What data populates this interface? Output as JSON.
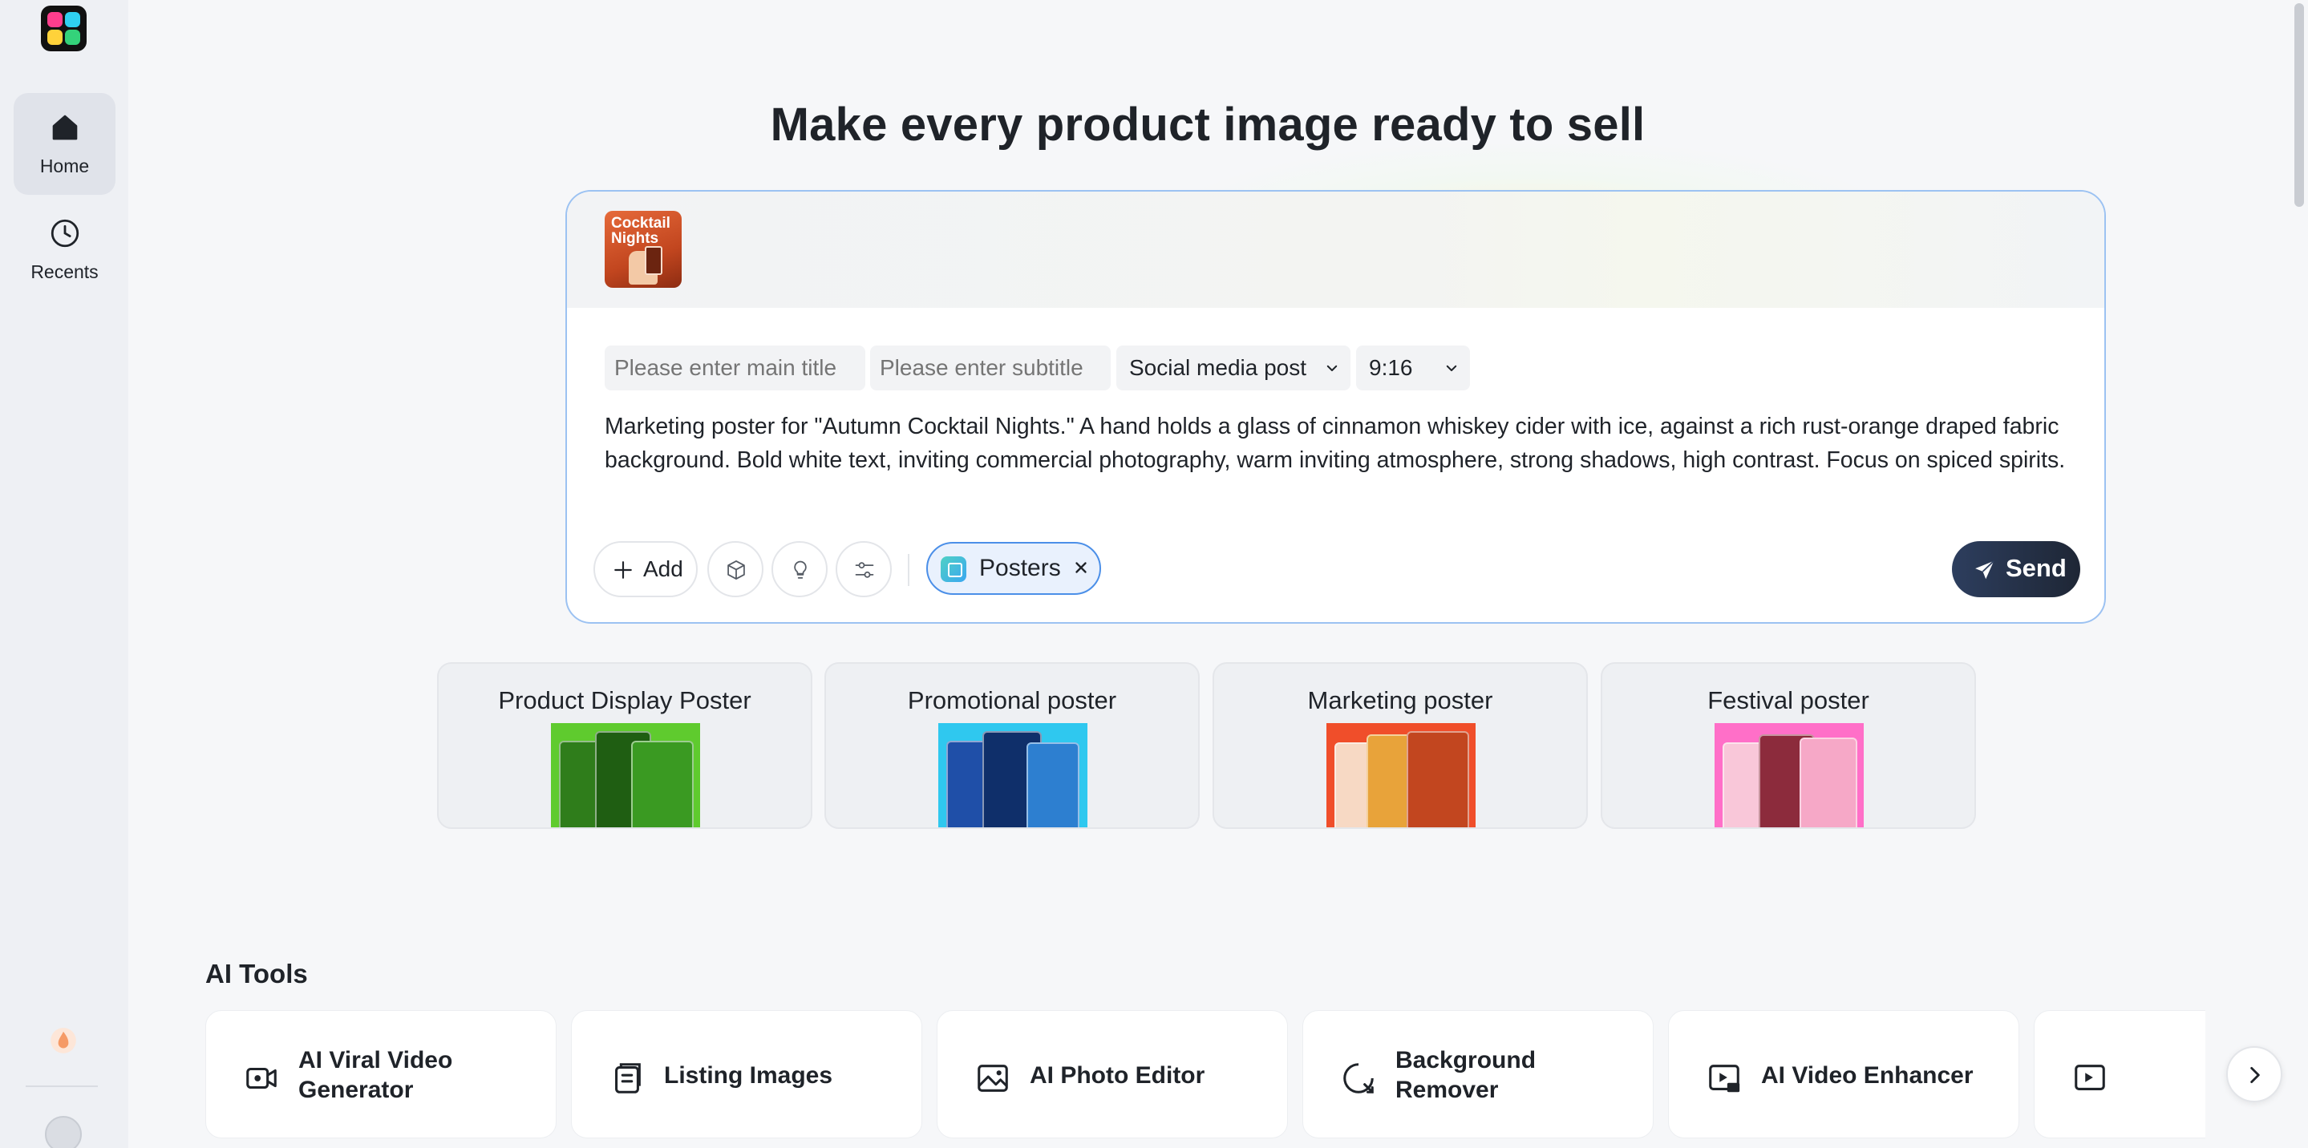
{
  "sidebar": {
    "items": [
      {
        "label": "Home",
        "icon": "home-icon",
        "active": true
      },
      {
        "label": "Recents",
        "icon": "clock-icon",
        "active": false
      }
    ]
  },
  "hero": {
    "title": "Make every product image ready to sell"
  },
  "composer": {
    "attachment_thumb_text": "Cocktail Nights",
    "main_title_placeholder": "Please enter main title",
    "subtitle_placeholder": "Please enter subtitle",
    "post_type": "Social media post",
    "aspect_ratio": "9:16",
    "prompt": "Marketing poster for \"Autumn Cocktail Nights.\" A hand holds a glass of cinnamon whiskey cider with ice, against a rich rust-orange draped fabric background. Bold white text, inviting commercial photography, warm inviting atmosphere, strong shadows, high contrast. Focus on spiced spirits.",
    "add_label": "Add",
    "chip_label": "Posters",
    "send_label": "Send"
  },
  "templates": [
    {
      "title": "Product Display Poster"
    },
    {
      "title": "Promotional poster"
    },
    {
      "title": "Marketing poster"
    },
    {
      "title": "Festival poster"
    }
  ],
  "ai_tools": {
    "title": "AI Tools",
    "items": [
      {
        "label": "AI Viral Video Generator",
        "icon": "video-generator-icon"
      },
      {
        "label": "Listing Images",
        "icon": "listing-images-icon"
      },
      {
        "label": "AI Photo Editor",
        "icon": "photo-editor-icon"
      },
      {
        "label": "Background Remover",
        "icon": "background-remover-icon"
      },
      {
        "label": "AI Video Enhancer",
        "icon": "video-enhancer-icon"
      }
    ]
  },
  "help": {
    "label": "?"
  },
  "colors": {
    "accent_border": "#9cc2f2",
    "chip_border": "#4b8fe8",
    "send_bg": "#1e2635"
  }
}
